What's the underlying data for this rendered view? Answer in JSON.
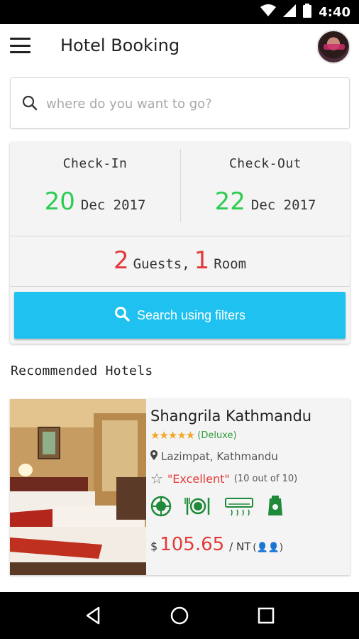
{
  "status_bar": {
    "time": "4:40"
  },
  "app_bar": {
    "title": "Hotel Booking"
  },
  "search": {
    "placeholder": "where do you want to go?",
    "value": ""
  },
  "booking": {
    "check_in": {
      "label": "Check-In",
      "day": "20",
      "month_year": "Dec 2017"
    },
    "check_out": {
      "label": "Check-Out",
      "day": "22",
      "month_year": "Dec 2017"
    },
    "guests": {
      "count": "2",
      "guests_label": "Guests,",
      "rooms": "1",
      "rooms_label": "Room"
    },
    "search_button": "Search using filters"
  },
  "recommended": {
    "title": "Recommended Hotels",
    "hotels": [
      {
        "name": "Shangrila Kathmandu",
        "stars": "★★★★★",
        "class": "(Deluxe)",
        "location": "Lazimpat, Kathmandu",
        "rating_text": "\"Excellent\"",
        "rating_sub": "(10 out of 10)",
        "currency": "$",
        "price": "105.65",
        "per": "/ NT",
        "guest_icons": "(👤👤)",
        "amenities": [
          "pool-icon",
          "restaurant-icon",
          "air-conditioner-icon",
          "laundry-icon"
        ]
      }
    ]
  },
  "colors": {
    "accent_green": "#2ecc52",
    "accent_red": "#e23a3a",
    "button_blue": "#1fc1f0",
    "star": "#f5a623"
  }
}
